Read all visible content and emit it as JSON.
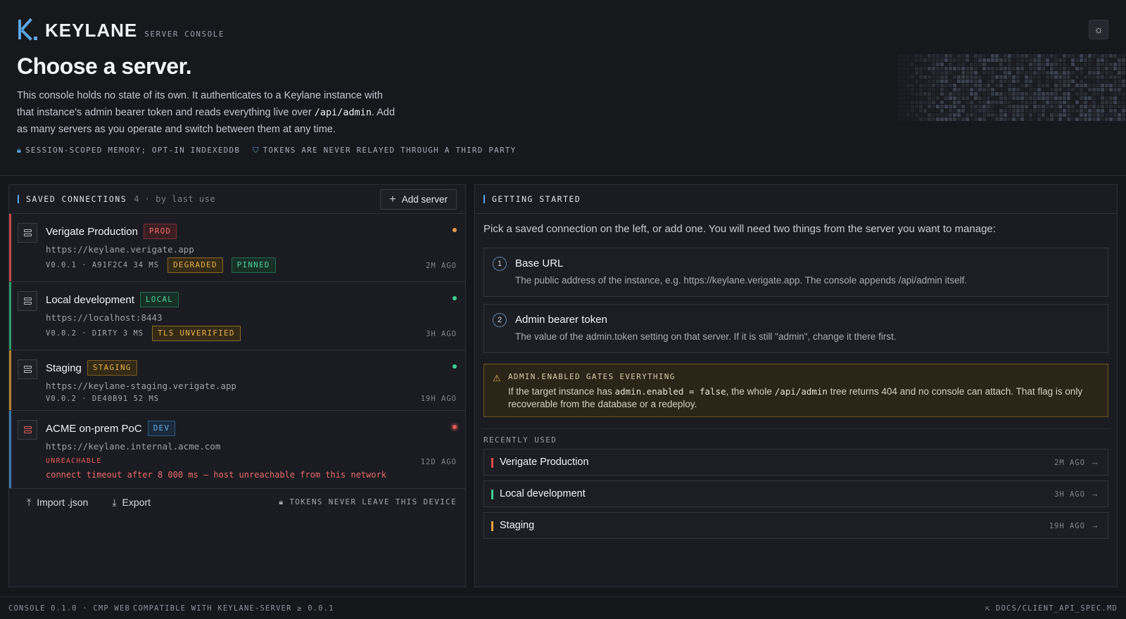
{
  "brand": {
    "name": "KEYLANE",
    "sub": "SERVER CONSOLE"
  },
  "theme_toggle": {
    "icon": "sun-icon"
  },
  "hero": {
    "title": "Choose a server.",
    "lede_1": "This console holds no state of its own. It authenticates to a Keylane instance with that instance's admin bearer token and reads everything live over ",
    "lede_code": "/api/admin",
    "lede_2": ". Add as many servers as you operate and switch between them at any time.",
    "note_1": "SESSION-SCOPED MEMORY; OPT-IN INDEXEDDB",
    "note_2": "TOKENS ARE NEVER RELAYED THROUGH A THIRD PARTY"
  },
  "saved": {
    "title": "SAVED CONNECTIONS",
    "meta": "4 · by last use",
    "add_label": "Add server",
    "connections": [
      {
        "name": "Verigate Production",
        "tag": "PROD",
        "url": "https://keylane.verigate.app",
        "meta": "V0.0.1 · A91F2C4  34 MS",
        "badges": [
          "DEGRADED",
          "PINNED"
        ],
        "ago": "2M AGO",
        "status_color": "#e89a4a",
        "stripe": "#c0484c"
      },
      {
        "name": "Local development",
        "tag": "LOCAL",
        "url": "https://localhost:8443",
        "meta": "V0.0.2 · DIRTY  3 MS",
        "badges": [
          "TLS UNVERIFIED"
        ],
        "ago": "3H AGO",
        "status_color": "#3fcf8e",
        "stripe": "#2f9a6a"
      },
      {
        "name": "Staging",
        "tag": "STAGING",
        "url": "https://keylane-staging.verigate.app",
        "meta": "V0.0.2 · DE40B91  52 MS",
        "badges": [],
        "ago": "19H AGO",
        "status_color": "#3fcf8e",
        "stripe": "#b5842c"
      },
      {
        "name": "ACME on-prem PoC",
        "tag": "DEV",
        "url": "https://keylane.internal.acme.com",
        "status": "UNREACHABLE",
        "error": "connect timeout after 8 000 ms — host unreachable from this network",
        "ago": "12D AGO",
        "status_color": "#e05a5a",
        "stripe": "#3f79b0"
      }
    ],
    "import_label": "Import .json",
    "export_label": "Export",
    "secure_note": "TOKENS NEVER LEAVE THIS DEVICE"
  },
  "getting_started": {
    "title": "GETTING STARTED",
    "intro": "Pick a saved connection on the left, or add one. You will need two things from the server you want to manage:",
    "steps": [
      {
        "num": "1",
        "title": "Base URL",
        "desc": "The public address of the instance, e.g. https://keylane.verigate.app. The console appends /api/admin itself."
      },
      {
        "num": "2",
        "title": "Admin bearer token",
        "desc": "The value of the admin.token setting on that server. If it is still \"admin\", change it there first."
      }
    ],
    "warning": {
      "title": "ADMIN.ENABLED GATES EVERYTHING",
      "pre": "If the target instance has ",
      "code_1": "admin.enabled = false",
      "mid": ", the whole ",
      "code_2": "/api/admin",
      "post": " tree returns 404 and no console can attach. That flag is only recoverable from the database or a redeploy."
    },
    "recent_label": "RECENTLY USED",
    "recent": [
      {
        "name": "Verigate Production",
        "ago": "2M AGO",
        "color": "#e0484c"
      },
      {
        "name": "Local development",
        "ago": "3H AGO",
        "color": "#3fcf8e"
      },
      {
        "name": "Staging",
        "ago": "19H AGO",
        "color": "#e5a43a"
      }
    ]
  },
  "footer": {
    "left": "CONSOLE 0.1.0 · CMP WEB",
    "middle": "COMPATIBLE WITH KEYLANE-SERVER ≥ 0.0.1",
    "right": "DOCS/CLIENT_API_SPEC.MD"
  }
}
